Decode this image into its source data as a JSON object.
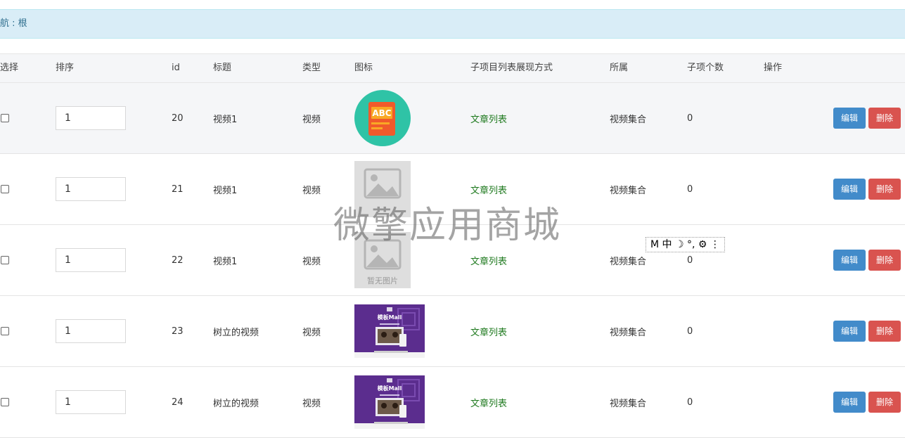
{
  "breadcrumb": {
    "text": "航 : 根"
  },
  "table": {
    "headers": {
      "select": "选择",
      "sort": "排序",
      "id": "id",
      "title": "标题",
      "type": "类型",
      "icon": "图标",
      "display_mode": "子项目列表展现方式",
      "belongs": "所属",
      "child_count": "子项个数",
      "actions": "操作"
    },
    "rows": [
      {
        "sort": "1",
        "id": "20",
        "title": "视频1",
        "type": "视频",
        "icon": "abc-book-icon",
        "display_mode": "文章列表",
        "belongs": "视频集合",
        "child_count": "0"
      },
      {
        "sort": "1",
        "id": "21",
        "title": "视频1",
        "type": "视频",
        "icon": "no-image-placeholder",
        "display_mode": "文章列表",
        "belongs": "视频集合",
        "child_count": "0"
      },
      {
        "sort": "1",
        "id": "22",
        "title": "视频1",
        "type": "视频",
        "icon": "no-image-placeholder",
        "display_mode": "文章列表",
        "belongs": "视频集合",
        "child_count": "0"
      },
      {
        "sort": "1",
        "id": "23",
        "title": "树立的视频",
        "type": "视频",
        "icon": "mall-banner-thumbnail",
        "display_mode": "文章列表",
        "belongs": "视频集合",
        "child_count": "0"
      },
      {
        "sort": "1",
        "id": "24",
        "title": "树立的视频",
        "type": "视频",
        "icon": "mall-banner-thumbnail",
        "display_mode": "文章列表",
        "belongs": "视频集合",
        "child_count": "0"
      }
    ],
    "edit_label": "编辑",
    "delete_label": "删除"
  },
  "placeholder": {
    "text": "暂无图片"
  },
  "banner": {
    "title": "模板Mall"
  },
  "watermark": {
    "text": "微擎应用商城"
  },
  "ime": {
    "text": "M 中 ☽ °, ⚙ ⋮"
  },
  "colors": {
    "edit": "#428bca",
    "delete": "#d9534f",
    "link": "#1f7a1f",
    "breadcrumb_bg": "#d9edf7"
  }
}
